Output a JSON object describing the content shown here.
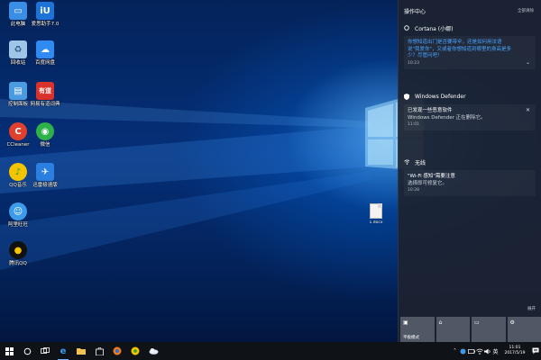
{
  "desktop": {
    "icons": [
      {
        "label": "此电脑",
        "icon": "computer-icon",
        "color": "#3a8ee6"
      },
      {
        "label": "爱思助手7.0",
        "icon": "aisi-assistant-icon",
        "color": "#1e73d8"
      },
      {
        "label": "回收站",
        "icon": "recycle-bin-icon",
        "color": "#9fc6e8"
      },
      {
        "label": "百度网盘",
        "icon": "baidu-netdisk-icon",
        "color": "#2f8af2"
      },
      {
        "label": "控制面板",
        "icon": "control-panel-icon",
        "color": "#4b9be0"
      },
      {
        "label": "网易有道词典",
        "icon": "youdao-dict-icon",
        "color": "#d9312b"
      },
      {
        "label": "CCleaner",
        "icon": "ccleaner-icon",
        "color": "#e0412e"
      },
      {
        "label": "微信",
        "icon": "wechat-icon",
        "color": "#2fb14a"
      },
      {
        "label": "QQ音乐",
        "icon": "qq-music-icon",
        "color": "#f2c500"
      },
      {
        "label": "迅雷极速版",
        "icon": "thunder-icon",
        "color": "#2a7fe0"
      },
      {
        "label": "阿里旺旺",
        "icon": "aliwangwang-icon",
        "color": "#3d9be9"
      },
      {
        "label": "腾讯QQ",
        "icon": "tencent-qq-icon",
        "color": "#111111"
      }
    ],
    "file": {
      "label": "1.docx",
      "icon": "document-file-icon"
    }
  },
  "action_center": {
    "title": "操作中心",
    "clear_all": "全部清除",
    "groups": [
      {
        "app": "Cortana (小娜)",
        "icon": "cortana-ring-icon",
        "lines": [
          "你想知道出门是否要带伞，还是如何用法语",
          "说\"我爱你\"，又或者你想知道到哪里的身高是多",
          "少？尽管问吧！"
        ],
        "time": "10:23",
        "style": "blue"
      },
      {
        "app": "Windows Defender",
        "icon": "shield-icon",
        "lines": [
          "已发现一些恶意软件",
          "Windows Defender 正在删除它。"
        ],
        "time": "11:01",
        "style": "gray"
      },
      {
        "app": "无线",
        "icon": "wifi-icon",
        "lines": [
          "\"Wi-Fi 感知\"需要注意",
          "选择即可修复它。"
        ],
        "time": "10:28",
        "style": "gray"
      }
    ],
    "expand": "展开",
    "quick_actions": [
      {
        "label": "平板模式",
        "icon": "tablet-mode-icon"
      },
      {
        "label": "",
        "icon": "home-icon"
      },
      {
        "label": "",
        "icon": "note-icon"
      },
      {
        "label": "",
        "icon": "settings-icon"
      }
    ]
  },
  "taskbar": {
    "apps": [
      {
        "name": "start",
        "icon": "windows-logo-icon"
      },
      {
        "name": "cortana",
        "icon": "cortana-search-icon"
      },
      {
        "name": "task-view",
        "icon": "task-view-icon"
      },
      {
        "name": "edge",
        "icon": "edge-icon"
      },
      {
        "name": "explorer",
        "icon": "folder-icon"
      },
      {
        "name": "store",
        "icon": "store-icon"
      },
      {
        "name": "browser",
        "icon": "browser-icon"
      },
      {
        "name": "music",
        "icon": "music-icon"
      },
      {
        "name": "weather",
        "icon": "weather-icon"
      }
    ],
    "tray": {
      "ime": "英",
      "clock_time": "11:01",
      "clock_date": "2017/5/19"
    }
  },
  "colors": {
    "accent_blue": "#4aa3ff",
    "action_center_bg": "#1c2230",
    "taskbar_bg": "#0f1217"
  }
}
